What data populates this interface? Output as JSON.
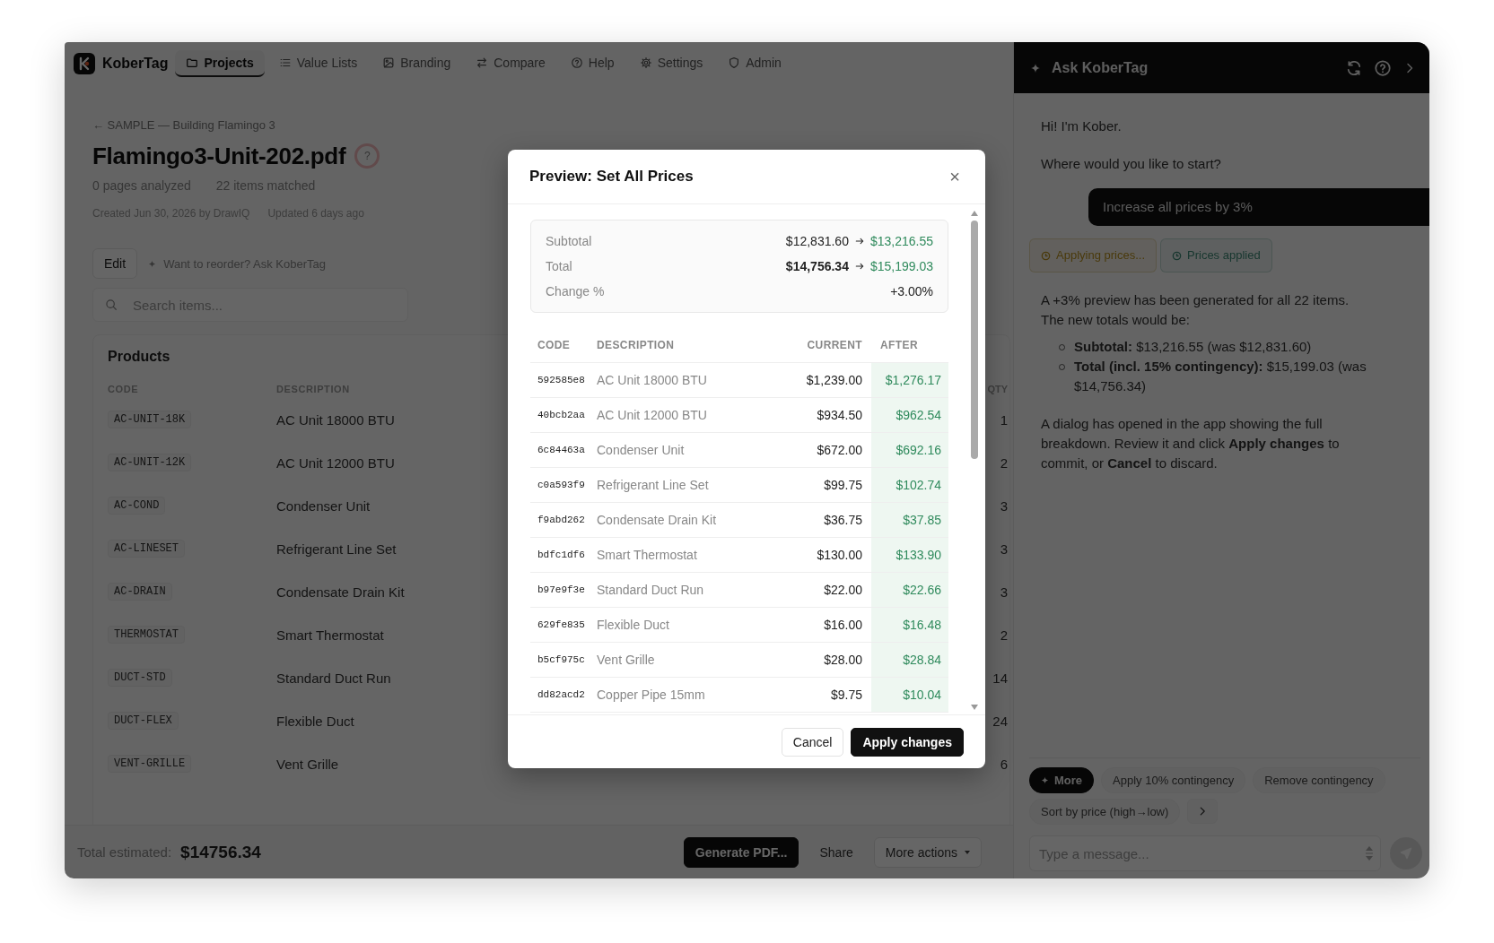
{
  "nav": {
    "brand": "KoberTag",
    "items": [
      {
        "label": "Projects",
        "selected": true
      },
      {
        "label": "Value Lists",
        "selected": false
      },
      {
        "label": "Branding",
        "selected": false
      },
      {
        "label": "Compare",
        "selected": false
      },
      {
        "label": "Help",
        "selected": false
      },
      {
        "label": "Settings",
        "selected": false
      },
      {
        "label": "Admin",
        "selected": false
      }
    ]
  },
  "document": {
    "breadcrumb": "← SAMPLE — Building Flamingo 3",
    "title": "Flamingo3-Unit-202.pdf",
    "help_badge": "?",
    "stats": [
      "0 pages analyzed",
      "22 items matched"
    ],
    "meta": [
      "Created Jun 30, 2026 by DrawIQ",
      "Updated 6 days ago"
    ]
  },
  "toolbar": {
    "edit": "Edit",
    "hint": "Want to reorder? Ask KoberTag"
  },
  "search": {
    "placeholder": "Search items..."
  },
  "products": {
    "title": "Products",
    "columns": [
      "CODE",
      "DESCRIPTION",
      "QTY"
    ],
    "rows": [
      {
        "code": "AC-UNIT-18K",
        "description": "AC Unit 18000 BTU",
        "qty": "1"
      },
      {
        "code": "AC-UNIT-12K",
        "description": "AC Unit 12000 BTU",
        "qty": "2"
      },
      {
        "code": "AC-COND",
        "description": "Condenser Unit",
        "qty": "3"
      },
      {
        "code": "AC-LINESET",
        "description": "Refrigerant Line Set",
        "qty": "3"
      },
      {
        "code": "AC-DRAIN",
        "description": "Condensate Drain Kit",
        "qty": "3"
      },
      {
        "code": "THERMOSTAT",
        "description": "Smart Thermostat",
        "qty": "2"
      },
      {
        "code": "DUCT-STD",
        "description": "Standard Duct Run",
        "qty": "14"
      },
      {
        "code": "DUCT-FLEX",
        "description": "Flexible Duct",
        "qty": "24"
      },
      {
        "code": "VENT-GRILLE",
        "description": "Vent Grille",
        "qty": "6"
      }
    ]
  },
  "footer": {
    "total_label": "Total estimated:",
    "total": "$14756.34",
    "buttons": [
      "Generate PDF...",
      "Share",
      "More actions"
    ]
  },
  "modal": {
    "title": "Preview: Set All Prices",
    "close": "×",
    "summary": [
      {
        "kind": "change",
        "label": "Subtotal",
        "before": "$12,831.60",
        "after": "$13,216.55",
        "emphasized": false
      },
      {
        "kind": "change",
        "label": "Total",
        "before": "$14,756.34",
        "after": "$15,199.03",
        "emphasized": true
      },
      {
        "kind": "value",
        "label": "Change %",
        "value": "+3.00%"
      }
    ],
    "columns": [
      "CODE",
      "DESCRIPTION",
      "CURRENT",
      "AFTER"
    ],
    "rows": [
      {
        "code": "592585e8",
        "description": "AC Unit 18000 BTU",
        "current": "$1,239.00",
        "after": "$1,276.17"
      },
      {
        "code": "40bcb2aa",
        "description": "AC Unit 12000 BTU",
        "current": "$934.50",
        "after": "$962.54"
      },
      {
        "code": "6c84463a",
        "description": "Condenser Unit",
        "current": "$672.00",
        "after": "$692.16"
      },
      {
        "code": "c0a593f9",
        "description": "Refrigerant Line Set",
        "current": "$99.75",
        "after": "$102.74"
      },
      {
        "code": "f9abd262",
        "description": "Condensate Drain Kit",
        "current": "$36.75",
        "after": "$37.85"
      },
      {
        "code": "bdfc1df6",
        "description": "Smart Thermostat",
        "current": "$130.00",
        "after": "$133.90"
      },
      {
        "code": "b97e9f3e",
        "description": "Standard Duct Run",
        "current": "$22.00",
        "after": "$22.66"
      },
      {
        "code": "629fe835",
        "description": "Flexible Duct",
        "current": "$16.00",
        "after": "$16.48"
      },
      {
        "code": "b5cf975c",
        "description": "Vent Grille",
        "current": "$28.00",
        "after": "$28.84"
      },
      {
        "code": "dd82acd2",
        "description": "Copper Pipe 15mm",
        "current": "$9.75",
        "after": "$10.04"
      }
    ],
    "buttons": [
      "Cancel",
      "Apply changes"
    ]
  },
  "chat": {
    "title": "Ask KoberTag",
    "messages": [
      {
        "kind": "assistant",
        "text": "Hi! I'm Kober."
      },
      {
        "kind": "assistant",
        "text": "Where would you like to start?"
      },
      {
        "kind": "user",
        "text": "Increase all prices by 3%"
      },
      {
        "kind": "status",
        "chips": [
          {
            "label": "Applying prices...",
            "kind": "pending"
          },
          {
            "label": "Prices applied",
            "kind": "done"
          }
        ]
      },
      {
        "kind": "assistant",
        "text": "A +3% preview has been generated for all 22 items. The new totals would be:",
        "bullets": [
          "**Subtotal:** $13,216.55 (was $12,831.60)",
          "**Total (incl. 15% contingency):** $15,199.03 (was $14,756.34)"
        ]
      },
      {
        "kind": "assistant",
        "text": "A dialog has opened in the app showing the full breakdown. Review it and click **Apply changes** to commit, or **Cancel** to discard."
      }
    ],
    "suggestions": [
      {
        "kind": "more",
        "label": "More"
      },
      {
        "kind": "plain",
        "label": "Apply 10% contingency"
      },
      {
        "kind": "plain",
        "label": "Remove contingency"
      },
      {
        "kind": "plain",
        "label": "Sort by price (high→low)"
      }
    ],
    "input": {
      "placeholder": "Type a message..."
    }
  }
}
